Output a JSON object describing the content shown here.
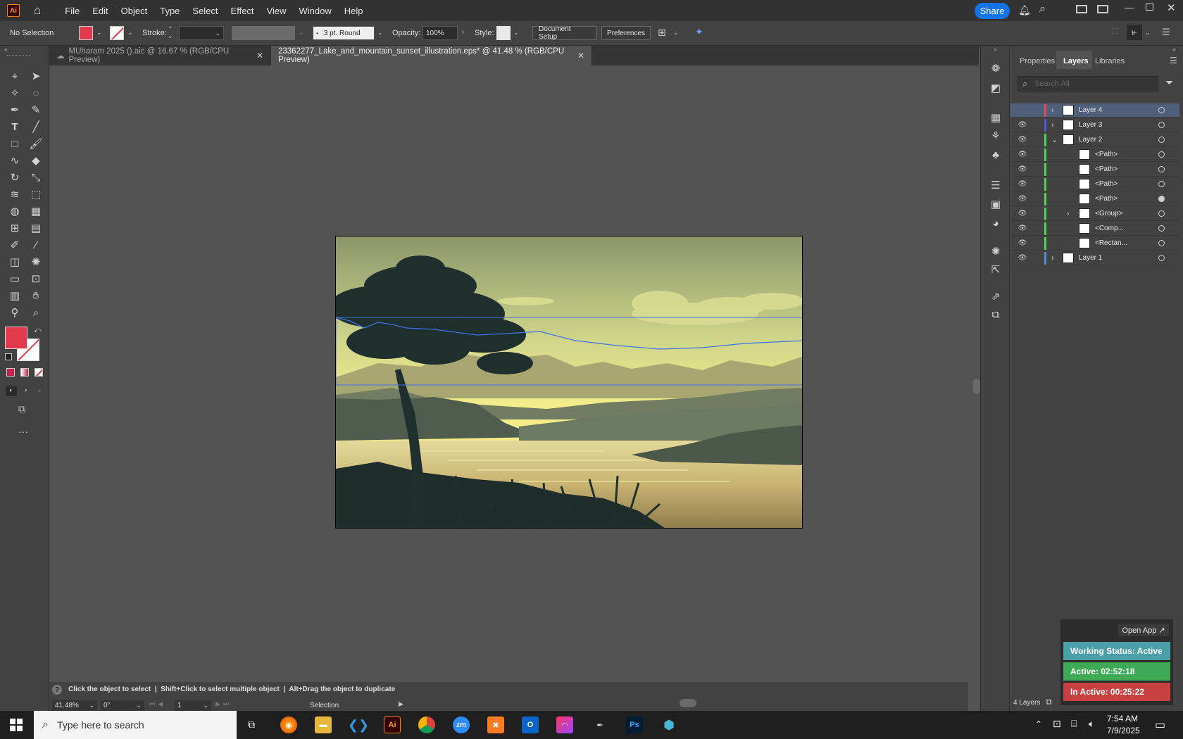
{
  "menubar": {
    "logo": "Ai",
    "items": [
      "File",
      "Edit",
      "Object",
      "Type",
      "Select",
      "Effect",
      "View",
      "Window",
      "Help"
    ],
    "share_label": "Share"
  },
  "controlbar": {
    "selection": "No Selection",
    "stroke_label": "Stroke:",
    "brush": "3 pt. Round",
    "opacity_label": "Opacity:",
    "opacity_value": "100%",
    "style_label": "Style:",
    "document_setup": "Document Setup",
    "preferences": "Preferences"
  },
  "tabs": [
    {
      "label": "MUharam 2025 ().aic @ 16.67 % (RGB/CPU Preview)",
      "active": false
    },
    {
      "label": "23362277_Lake_and_mountain_sunset_illustration.eps* @ 41.48 % (RGB/CPU Preview)",
      "active": true
    }
  ],
  "panel": {
    "tabs": [
      "Properties",
      "Layers",
      "Libraries"
    ],
    "search_placeholder": "Search All",
    "layers": [
      {
        "name": "Layer 4",
        "color": "#e8474c",
        "selected": true
      },
      {
        "name": "Layer 3",
        "color": "#4f5bd5"
      },
      {
        "name": "Layer 2",
        "color": "#4fd54f",
        "expanded": true
      },
      {
        "name": "<Path>",
        "color": "#4fd54f",
        "child": true
      },
      {
        "name": "<Path>",
        "color": "#4fd54f",
        "child": true
      },
      {
        "name": "<Path>",
        "color": "#4fd54f",
        "child": true
      },
      {
        "name": "<Path>",
        "color": "#4fd54f",
        "child": true
      },
      {
        "name": "<Group>",
        "color": "#4fd54f",
        "child": true
      },
      {
        "name": "<Comp...",
        "color": "#4fd54f",
        "child": true
      },
      {
        "name": "<Rectan...",
        "color": "#4fd54f",
        "child": true
      },
      {
        "name": "Layer 1",
        "color": "#4f8fd5"
      }
    ],
    "layer_count": "4 Layers"
  },
  "statusbar": {
    "hint": "Click the object to select  |  Shift+Click to select multiple object  |  Alt+Drag the object to duplicate",
    "zoom": "41.48%",
    "rotation": "0°",
    "artboard": "1",
    "tool": "Selection"
  },
  "widget": {
    "open_app": "Open App ↗",
    "status": "Working Status: Active",
    "active": "Active: 02:52:18",
    "inactive": "In Active: 00:25:22"
  },
  "taskbar": {
    "search_placeholder": "Type here to search",
    "time": "7:54 AM",
    "date": "7/9/2025"
  },
  "colors": {
    "fill": "#e23a4c",
    "accent": "#1473e6"
  }
}
